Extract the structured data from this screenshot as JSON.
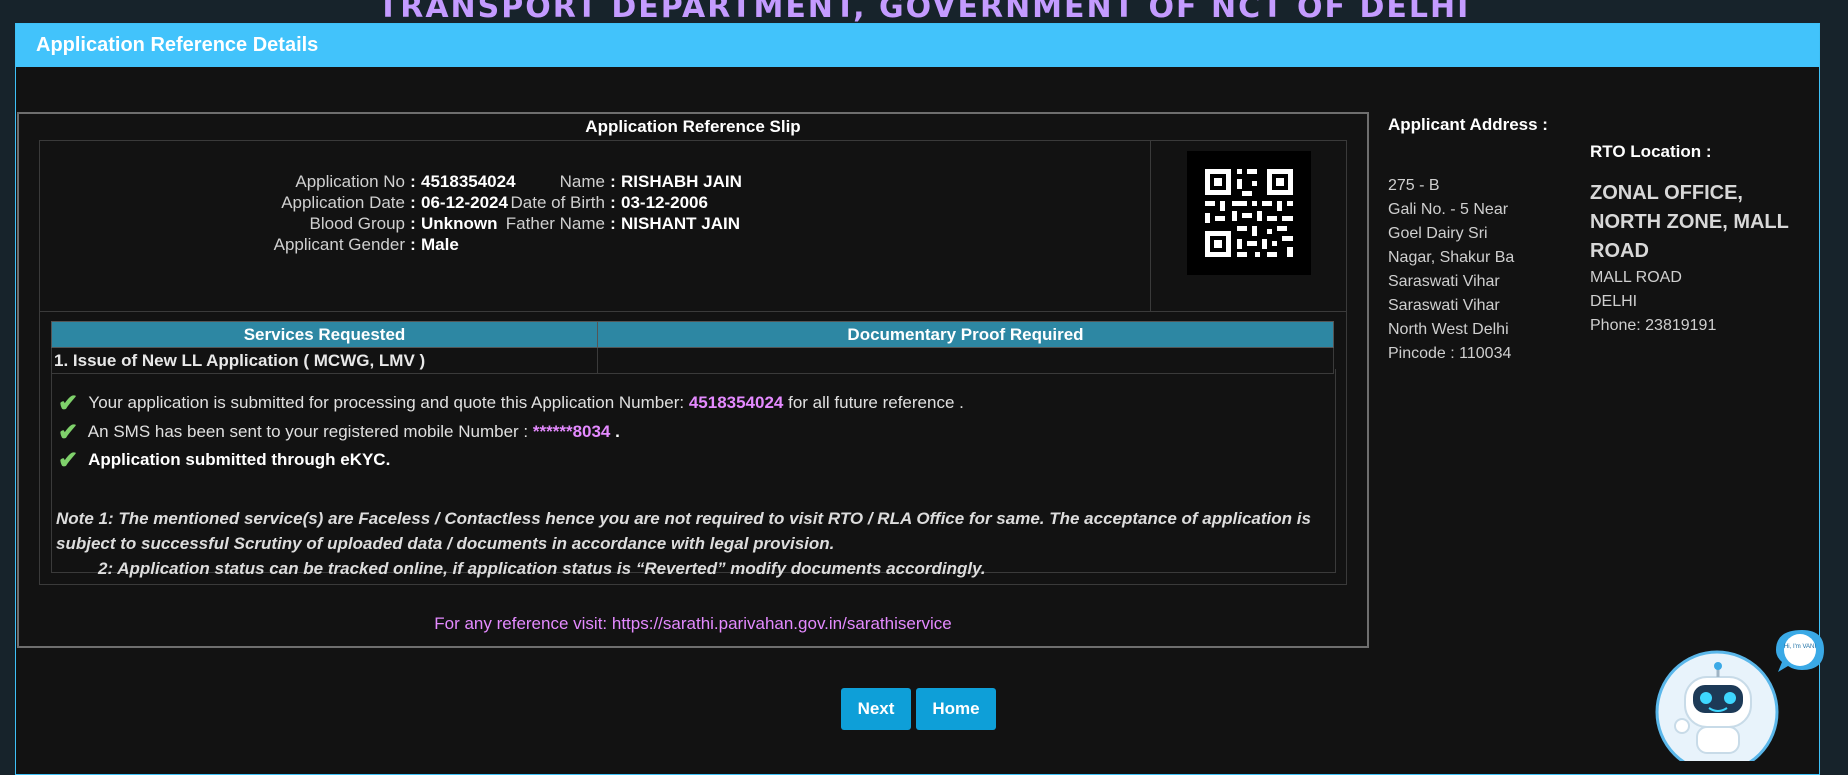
{
  "header": {
    "department": "TRANSPORT DEPARTMENT, GOVERNMENT OF NCT OF DELHI"
  },
  "panel": {
    "title": "Application Reference Details"
  },
  "slip": {
    "title": "Application Reference Slip",
    "left_fields": [
      {
        "label": "Application No",
        "value": "4518354024"
      },
      {
        "label": "Application Date",
        "value": "06-12-2024"
      },
      {
        "label": "Blood Group",
        "value": "Unknown"
      },
      {
        "label": "Applicant Gender",
        "value": "Male"
      }
    ],
    "right_fields": [
      {
        "label": "Name",
        "value": "RISHABH JAIN"
      },
      {
        "label": "Date of Birth",
        "value": "03-12-2006"
      },
      {
        "label": "Father Name",
        "value": "NISHANT JAIN"
      }
    ],
    "colon": ":",
    "services_header": [
      "Services Requested",
      "Documentary Proof Required"
    ],
    "services": [
      [
        "1. Issue of New LL Application ( MCWG, LMV )",
        ""
      ]
    ],
    "messages": {
      "m1_pre": "Your application is submitted for processing and quote this Application Number:",
      "m1_app_no": "4518354024",
      "m1_post": "for all future reference .",
      "m2_pre": "An SMS has been sent to your registered mobile Number :",
      "m2_mobile": "******8034",
      "m2_post": ".",
      "m3": "Application submitted through eKYC."
    },
    "note1": "Note 1:  The mentioned service(s) are Faceless / Contactless hence you are not required to visit RTO / RLA Office for same. The acceptance of application is subject to successful Scrutiny of uploaded data / documents in accordance with legal provision.",
    "note2": "2:  Application status can be tracked online, if application status is “Reverted” modify documents accordingly.",
    "reference": "For any reference visit: https://sarathi.parivahan.gov.in/sarathiservice"
  },
  "address": {
    "title": "Applicant Address :",
    "lines": [
      "275 - B",
      "Gali No. - 5 Near",
      "Goel Dairy Sri",
      "Nagar, Shakur Ba",
      "Saraswati Vihar",
      "Saraswati Vihar",
      "North West Delhi",
      "Pincode : 110034"
    ]
  },
  "rto": {
    "title": "RTO Location :",
    "name": "ZONAL OFFICE, NORTH ZONE, MALL ROAD",
    "lines": [
      "MALL ROAD",
      "DELHI",
      "Phone:  23819191"
    ]
  },
  "buttons": {
    "next": "Next",
    "home": "Home"
  },
  "chatbot": {
    "bubble": "Hi, I'm VANI"
  },
  "icons": {
    "check": "checkmark-icon",
    "qr": "qr-code-icon",
    "bot": "chatbot-icon"
  }
}
